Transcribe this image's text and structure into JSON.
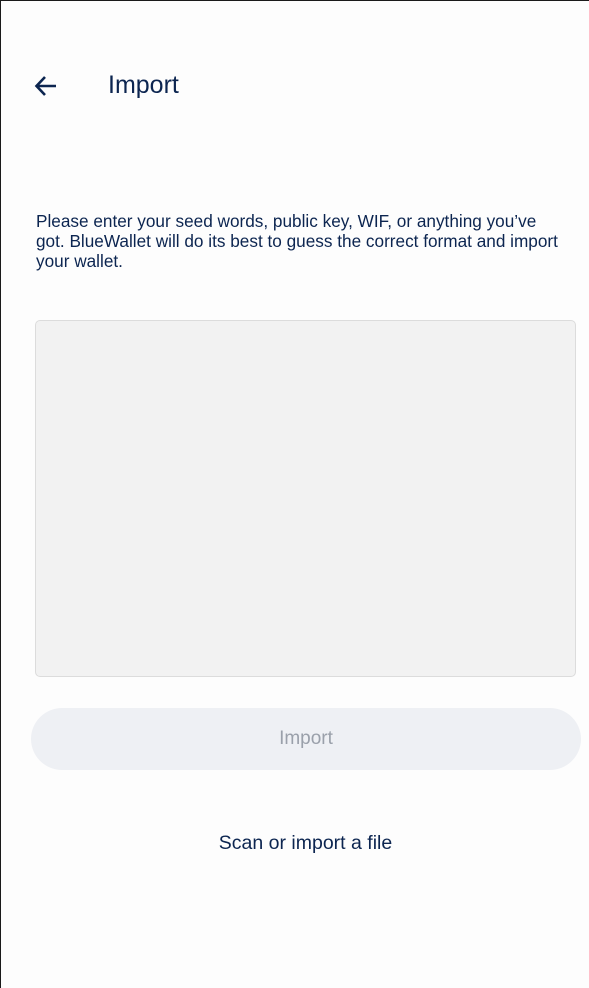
{
  "header": {
    "back_icon": "arrow-left-icon",
    "title": "Import"
  },
  "main": {
    "description": "Please enter your seed words, public key, WIF, or anything you’ve got. BlueWallet will do its best to guess the correct format and import your wallet.",
    "input": {
      "value": "",
      "placeholder": ""
    },
    "import_button_label": "Import",
    "scan_link_label": "Scan or import a file"
  },
  "colors": {
    "text_primary": "#0c2550",
    "input_background": "#f2f2f2",
    "button_disabled_background": "#eef0f4",
    "button_disabled_text": "#9aa0aa"
  }
}
